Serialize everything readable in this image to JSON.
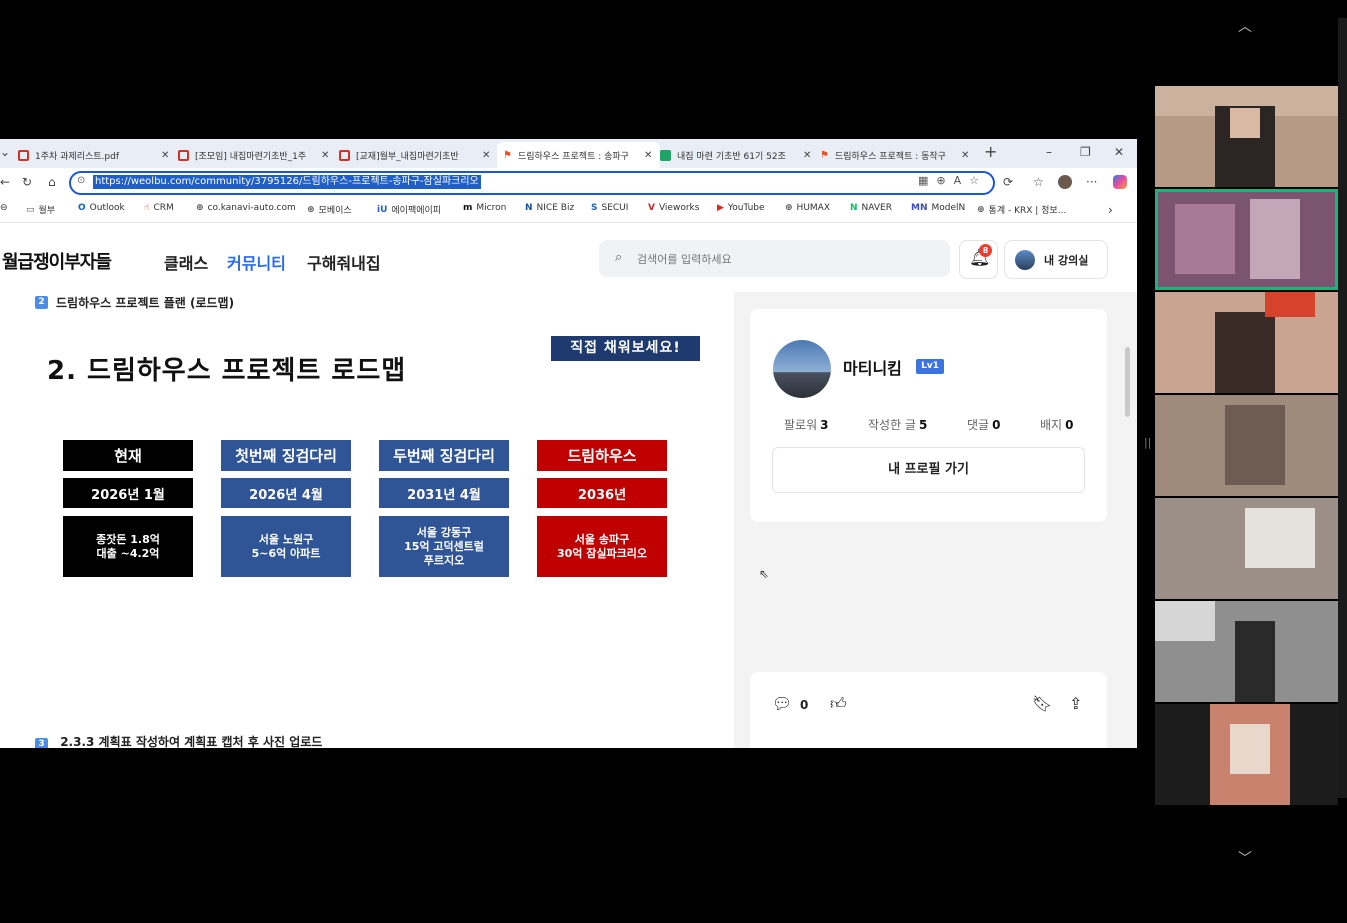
{
  "browser": {
    "tabs": [
      {
        "title": "1주차 과제리스트.pdf",
        "icon_color": "#d93025"
      },
      {
        "title": "[조모임] 내집마련기초반_1주",
        "icon_color": "#d93025"
      },
      {
        "title": "[교재]월부_내집마련기초반",
        "icon_color": "#d93025"
      },
      {
        "title": "드림하우스 프로젝트 : 송파구",
        "icon_color": "#e8542a"
      },
      {
        "title": "내집 마련 기초반 61기 52조",
        "icon_color": "#1fa463"
      },
      {
        "title": "드림하우스 프로젝트 : 동작구",
        "icon_color": "#e8542a"
      }
    ],
    "close_glyph": "✕",
    "new_tab_glyph": "+",
    "url": "https://weolbu.com/community/3795126/드림하우스-프로젝트-송파구-잠실파크리오",
    "bookmarks": [
      {
        "label": "월부",
        "icon": "folder-icon",
        "glyph": "▭",
        "color": "#555"
      },
      {
        "label": "Outlook",
        "icon": "outlook-icon",
        "glyph": "O",
        "color": "#0a64c2"
      },
      {
        "label": "CRM",
        "icon": "hand-icon",
        "glyph": "☝",
        "color": "#d33"
      },
      {
        "label": "co.kanavi-auto.com",
        "icon": "globe-icon",
        "glyph": "⊕",
        "color": "#555"
      },
      {
        "label": "모베이스",
        "icon": "globe-icon",
        "glyph": "⊕",
        "color": "#555"
      },
      {
        "label": "에이팩에이피",
        "icon": "iu-icon",
        "glyph": "iU",
        "color": "#2a5bd7"
      },
      {
        "label": "Micron",
        "icon": "micron-icon",
        "glyph": "m",
        "color": "#111"
      },
      {
        "label": "NICE Biz",
        "icon": "nice-icon",
        "glyph": "N",
        "color": "#1b4ea8"
      },
      {
        "label": "SECUI",
        "icon": "secui-icon",
        "glyph": "S",
        "color": "#1565c0"
      },
      {
        "label": "Vieworks",
        "icon": "vieworks-icon",
        "glyph": "V",
        "color": "#c62828"
      },
      {
        "label": "YouTube",
        "icon": "youtube-icon",
        "glyph": "▶",
        "color": "#e62117"
      },
      {
        "label": "HUMAX",
        "icon": "globe-icon",
        "glyph": "⊕",
        "color": "#555"
      },
      {
        "label": "NAVER",
        "icon": "naver-icon",
        "glyph": "N",
        "color": "#03c75a"
      },
      {
        "label": "ModelN",
        "icon": "modeln-icon",
        "glyph": "MN",
        "color": "#3d4db7"
      },
      {
        "label": "통계 - KRX | 정보...",
        "icon": "globe-icon",
        "glyph": "⊕",
        "color": "#555"
      }
    ]
  },
  "site": {
    "logo": "월급쟁이부자들",
    "nav": [
      "클래스",
      "커뮤니티",
      "구해줘내집"
    ],
    "search_placeholder": "검색어를 입력하세요",
    "notification_count": "8",
    "my_lecture_label": "내 강의실"
  },
  "post": {
    "section_number": "2",
    "section_heading": "드림하우스 프로젝트 플랜 (로드맵)",
    "slide_title": "2. 드림하우스 프로젝트 로드맵",
    "fill_in_label": "직접 채워보세요!",
    "roadmap": [
      {
        "stage": "현재",
        "date": "2026년 1월",
        "detail": "종잣돈 1.8억\n대출 ~4.2억",
        "color": "#000000"
      },
      {
        "stage": "첫번째 징검다리",
        "date": "2026년 4월",
        "detail": "서울 노원구\n5~6억 아파트",
        "color": "#2f5597"
      },
      {
        "stage": "두번째 징검다리",
        "date": "2031년 4월",
        "detail": "서울 강동구\n15억 고덕센트럴\n푸르지오",
        "color": "#2f5597"
      },
      {
        "stage": "드림하우스",
        "date": "2036년",
        "detail": "서울 송파구\n30억 잠실파크리오",
        "color": "#c00000"
      }
    ],
    "next_section_number": "3",
    "next_section_partial": "2.3.3 계획표 작성하여 계획표 캡처 후 사진 업로드"
  },
  "profile": {
    "name": "마티니킴",
    "level": "Lv1",
    "stats": [
      {
        "label": "팔로워",
        "value": "3"
      },
      {
        "label": "작성한 글",
        "value": "5"
      },
      {
        "label": "댓글",
        "value": "0"
      },
      {
        "label": "배지",
        "value": "0"
      }
    ],
    "profile_button": "내 프로필 가기"
  },
  "actions": {
    "comment_count": "0"
  },
  "colors": {
    "accent": "#2a6cf0",
    "active_speaker": "#1db37a"
  }
}
